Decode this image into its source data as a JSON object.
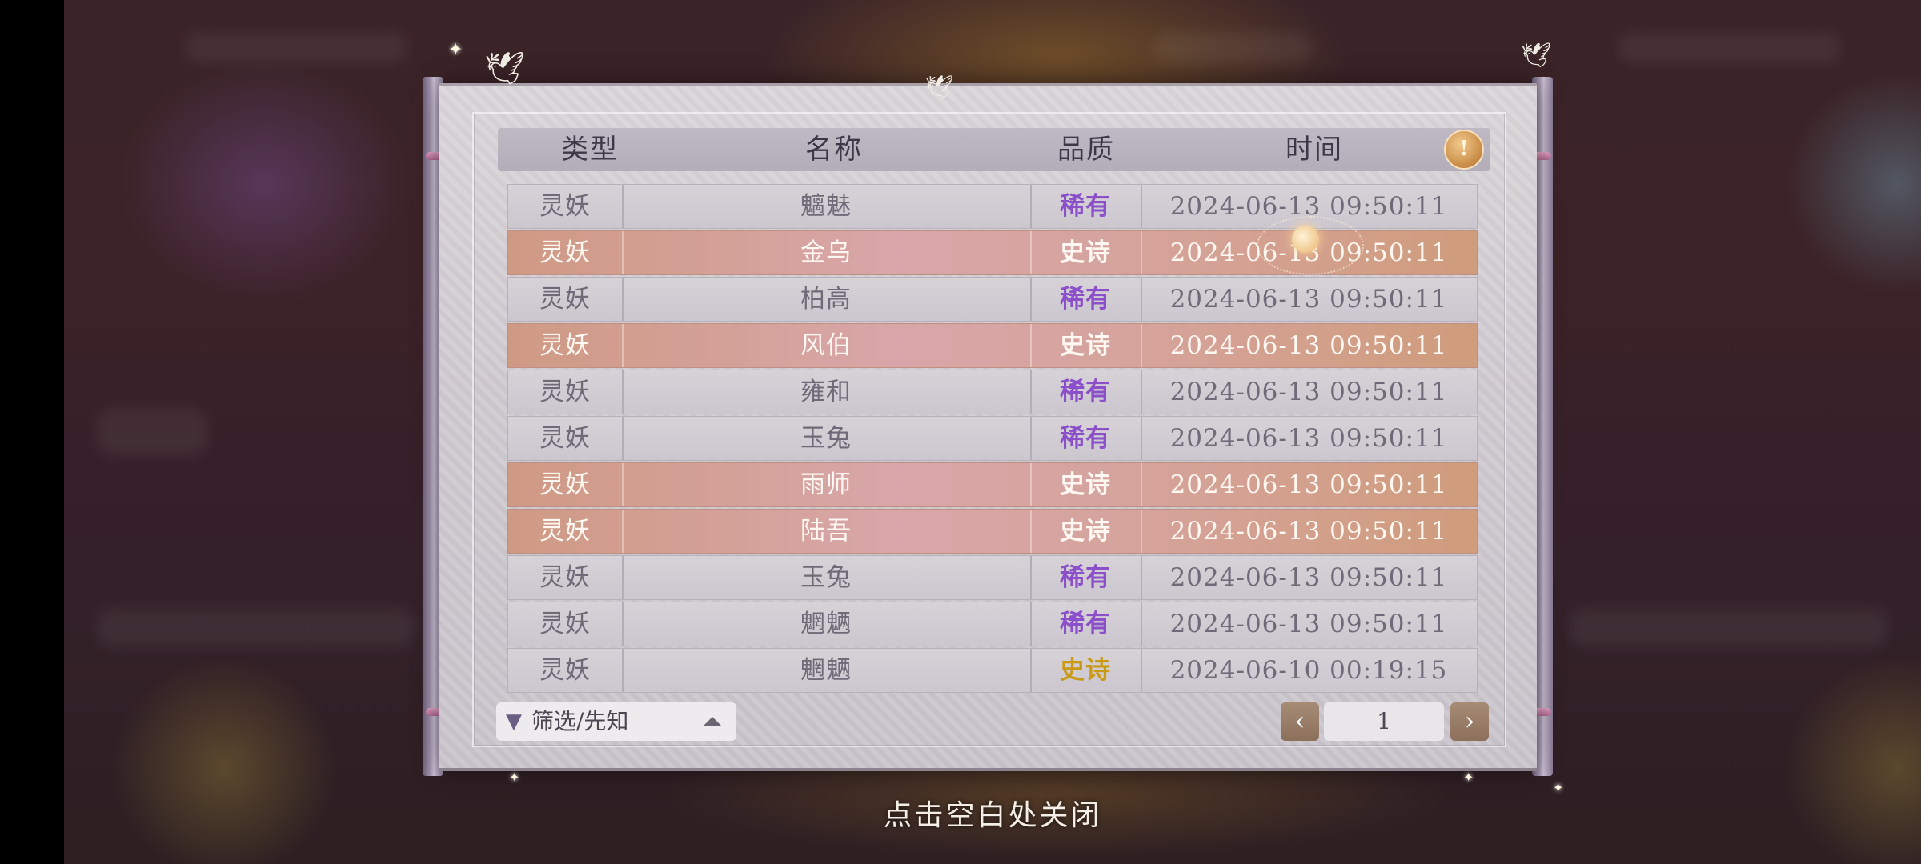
{
  "table": {
    "headers": {
      "type": "类型",
      "name": "名称",
      "quality": "品质",
      "time": "时间"
    },
    "rows": [
      {
        "type": "灵妖",
        "name": "魑魅",
        "quality": "稀有",
        "time": "2024-06-13  09:50:11",
        "tier": "rare"
      },
      {
        "type": "灵妖",
        "name": "金乌",
        "quality": "史诗",
        "time": "2024-06-13  09:50:11",
        "tier": "epic"
      },
      {
        "type": "灵妖",
        "name": "柏高",
        "quality": "稀有",
        "time": "2024-06-13  09:50:11",
        "tier": "rare"
      },
      {
        "type": "灵妖",
        "name": "风伯",
        "quality": "史诗",
        "time": "2024-06-13  09:50:11",
        "tier": "epic"
      },
      {
        "type": "灵妖",
        "name": "雍和",
        "quality": "稀有",
        "time": "2024-06-13  09:50:11",
        "tier": "rare"
      },
      {
        "type": "灵妖",
        "name": "玉兔",
        "quality": "稀有",
        "time": "2024-06-13  09:50:11",
        "tier": "rare"
      },
      {
        "type": "灵妖",
        "name": "雨师",
        "quality": "史诗",
        "time": "2024-06-13  09:50:11",
        "tier": "epic"
      },
      {
        "type": "灵妖",
        "name": "陆吾",
        "quality": "史诗",
        "time": "2024-06-13  09:50:11",
        "tier": "epic"
      },
      {
        "type": "灵妖",
        "name": "玉兔",
        "quality": "稀有",
        "time": "2024-06-13  09:50:11",
        "tier": "rare"
      },
      {
        "type": "灵妖",
        "name": "魍魉",
        "quality": "稀有",
        "time": "2024-06-13  09:50:11",
        "tier": "rare"
      },
      {
        "type": "灵妖",
        "name": "魍魉",
        "quality": "史诗",
        "time": "2024-06-10  00:19:15",
        "tier": "epic-gold"
      }
    ]
  },
  "filter": {
    "label": "筛选/先知",
    "icon": "filter-icon"
  },
  "pagination": {
    "current_page": "1",
    "prev_icon": "chevron-left-icon",
    "next_icon": "chevron-right-icon"
  },
  "info_button": {
    "label": "!",
    "icon": "info-icon"
  },
  "close_hint": "点击空白处关闭",
  "colors": {
    "rare_text": "#8a4fc9",
    "epic_row": "#d6a39c",
    "epic_gold_text": "#c99a16",
    "scroll_bg": "#d4d0d5"
  }
}
